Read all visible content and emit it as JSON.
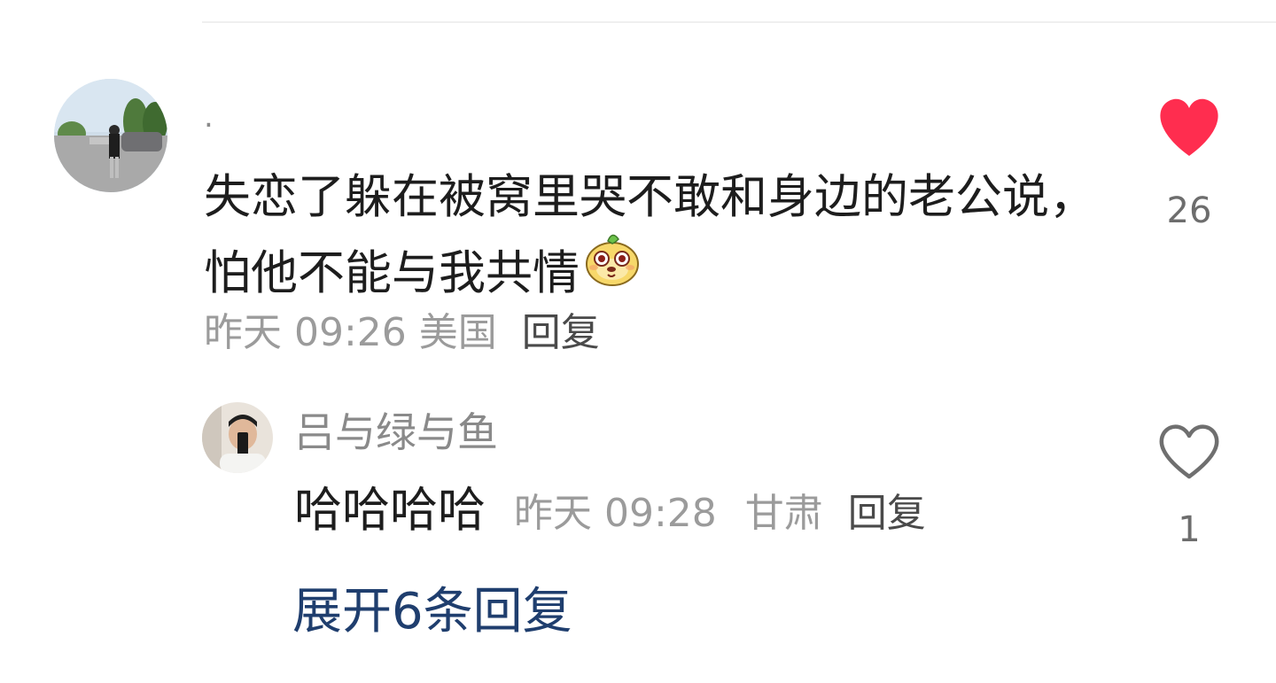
{
  "comment": {
    "username": ".",
    "text": "失恋了躲在被窝里哭不敢和身边的老公说，怕他不能与我共情",
    "emoji_icon": "cute-face-emoji",
    "time": "昨天 09:26",
    "location": "美国",
    "reply_label": "回复",
    "like_count": "26",
    "liked": true,
    "like_color": "#ff2d4f"
  },
  "reply": {
    "username": "吕与绿与鱼",
    "text": "哈哈哈哈",
    "time": "昨天 09:28",
    "location": "甘肃",
    "reply_label": "回复",
    "like_count": "1",
    "liked": false
  },
  "expand_label": "展开6条回复",
  "colors": {
    "link": "#1f3e6e",
    "meta": "#9b9b9b",
    "text": "#1d1d1d"
  }
}
